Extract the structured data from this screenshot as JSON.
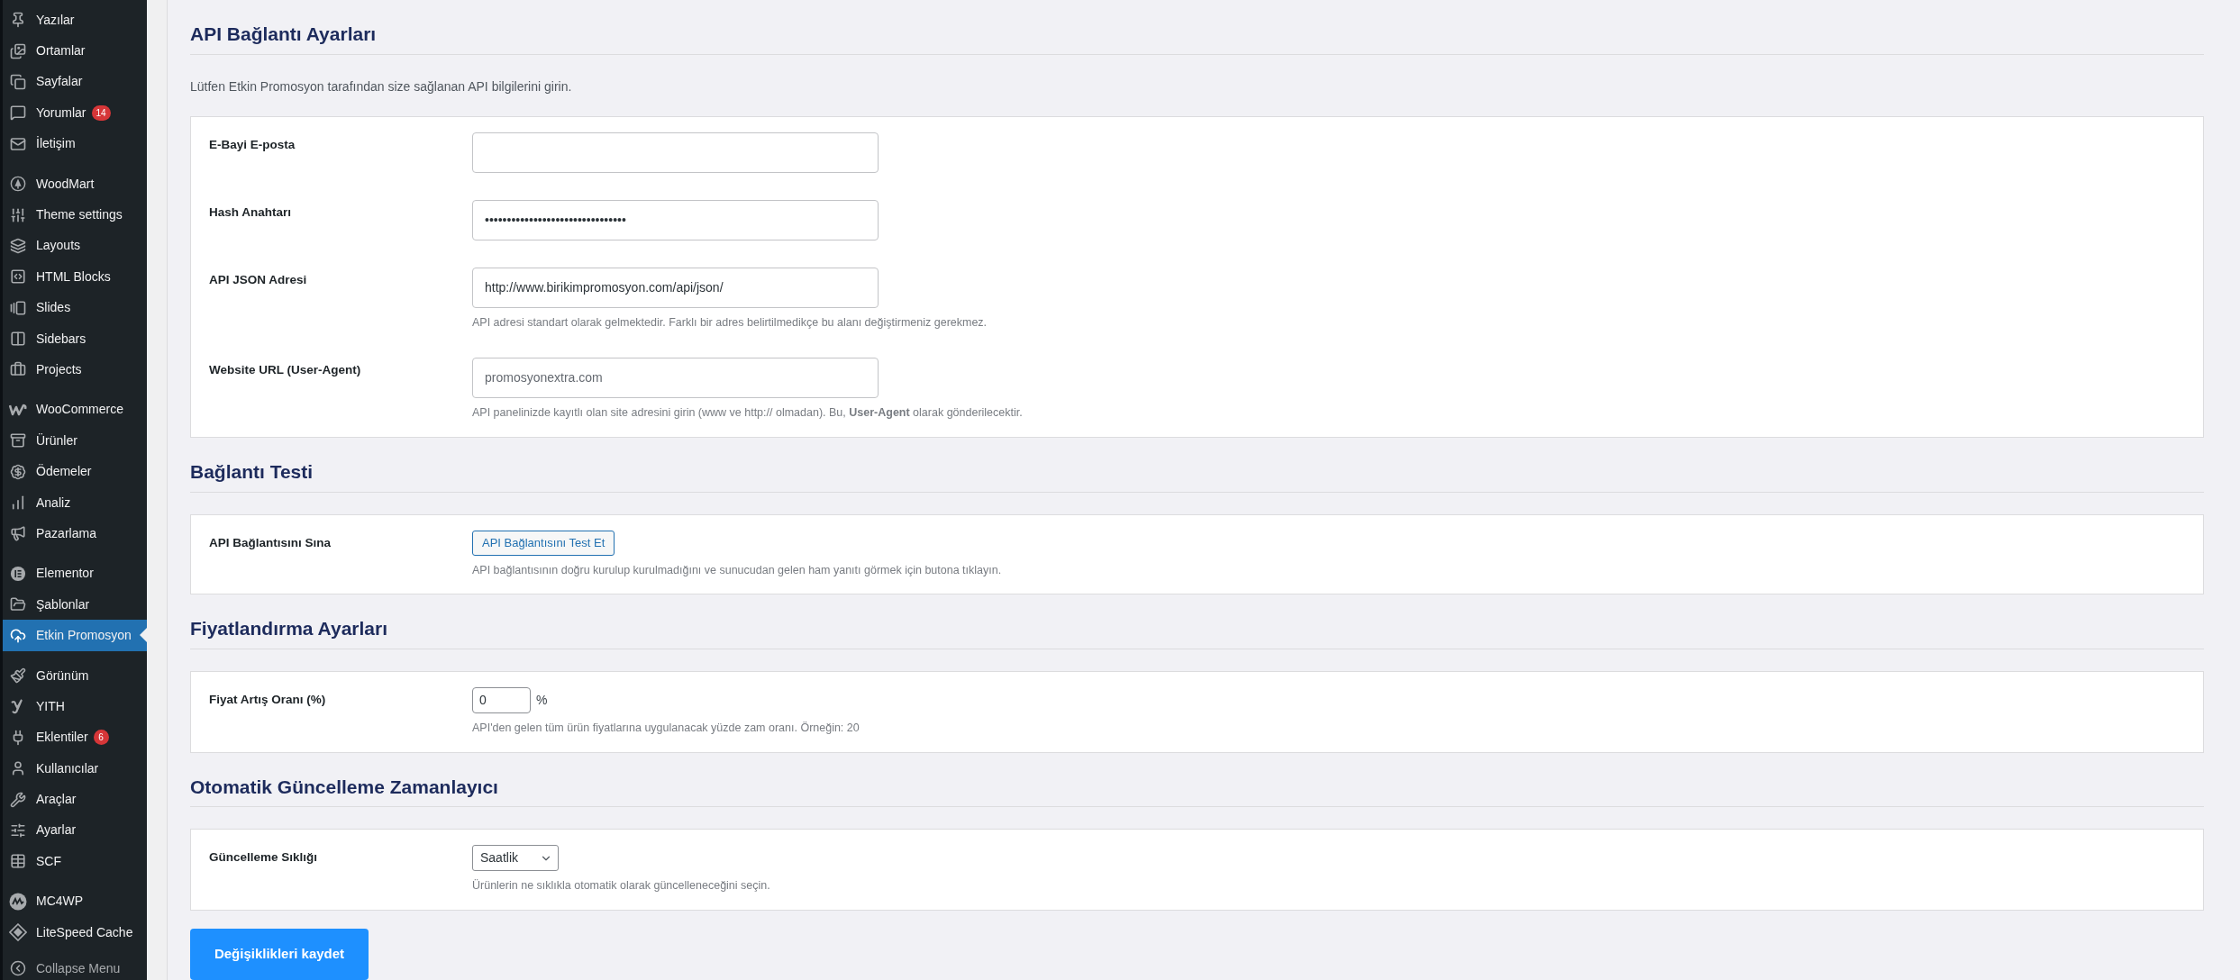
{
  "sidebar": {
    "groups": [
      {
        "items": [
          {
            "label": "Yazılar",
            "selected": false
          },
          {
            "label": "Ortamlar",
            "selected": false
          },
          {
            "label": "Sayfalar",
            "selected": false
          },
          {
            "label": "Yorumlar",
            "selected": false,
            "badge": "14"
          },
          {
            "label": "İletişim",
            "selected": false
          }
        ]
      },
      {
        "items": [
          {
            "label": "WoodMart",
            "selected": false
          },
          {
            "label": "Theme settings",
            "selected": false
          },
          {
            "label": "Layouts",
            "selected": false
          },
          {
            "label": "HTML Blocks",
            "selected": false
          },
          {
            "label": "Slides",
            "selected": false
          },
          {
            "label": "Sidebars",
            "selected": false
          },
          {
            "label": "Projects",
            "selected": false
          }
        ]
      },
      {
        "items": [
          {
            "label": "WooCommerce",
            "selected": false
          },
          {
            "label": "Ürünler",
            "selected": false
          },
          {
            "label": "Ödemeler",
            "selected": false
          },
          {
            "label": "Analiz",
            "selected": false
          },
          {
            "label": "Pazarlama",
            "selected": false
          }
        ]
      },
      {
        "items": [
          {
            "label": "Elementor",
            "selected": false
          },
          {
            "label": "Şablonlar",
            "selected": false
          },
          {
            "label": "Etkin Promosyon",
            "selected": true
          }
        ]
      },
      {
        "items": [
          {
            "label": "Görünüm",
            "selected": false
          },
          {
            "label": "YITH",
            "selected": false
          },
          {
            "label": "Eklentiler",
            "selected": false,
            "badge": "6"
          },
          {
            "label": "Kullanıcılar",
            "selected": false
          },
          {
            "label": "Araçlar",
            "selected": false
          },
          {
            "label": "Ayarlar",
            "selected": false
          },
          {
            "label": "SCF",
            "selected": false
          }
        ]
      },
      {
        "items": [
          {
            "label": "MC4WP",
            "selected": false
          },
          {
            "label": "LiteSpeed Cache",
            "selected": false
          }
        ]
      }
    ],
    "collapse_menu": "Collapse Menu"
  },
  "sections": [
    {
      "title": "API Bağlantı Ayarları",
      "description": "Lütfen Etkin Promosyon tarafından size sağlanan API bilgilerini girin.",
      "rows": [
        {
          "label": "E-Bayi E-posta",
          "kind": "text"
        },
        {
          "label": "Hash Anahtarı",
          "kind": "text",
          "value": "••••••••••••••••••••••••••••••••"
        },
        {
          "label": "API JSON Adresi",
          "kind": "text",
          "value": "http://www.birikimpromosyon.com/api/json/",
          "help": "API adresi standart olarak gelmektedir. Farklı bir adres belirtilmedikçe bu alanı değiştirmeniz gerekmez."
        },
        {
          "label": "Website URL (User-Agent)",
          "kind": "text",
          "placeholder": "promosyonextra.com",
          "help": "API panelinizde kayıtlı olan site adresini girin (www ve http:// olmadan). Bu, **User-Agent** olarak gönderilecektir."
        }
      ]
    },
    {
      "title": "Bağlantı Testi",
      "rows": [
        {
          "label": "API Bağlantısını Sına",
          "kind": "button",
          "value": "API Bağlantısını Test Et",
          "help": "API bağlantısının doğru kurulup kurulmadığını ve sunucudan gelen ham yanıtı görmek için butona tıklayın."
        }
      ]
    },
    {
      "title": "Fiyatlandırma Ayarları",
      "rows": [
        {
          "label": "Fiyat Artış Oranı (%)",
          "kind": "number",
          "value": "0",
          "suffix": "%",
          "help": "API'den gelen tüm ürün fiyatlarına uygulanacak yüzde zam oranı. Örneğin: 20"
        }
      ]
    },
    {
      "title": "Otomatik Güncelleme Zamanlayıcı",
      "rows": [
        {
          "label": "Güncelleme Sıklığı",
          "kind": "select",
          "value": "Saatlik",
          "help": "Ürünlerin ne sıklıkla otomatik olarak güncelleneceğini seçin."
        }
      ]
    }
  ],
  "save_button": "Değişiklikleri kaydet"
}
